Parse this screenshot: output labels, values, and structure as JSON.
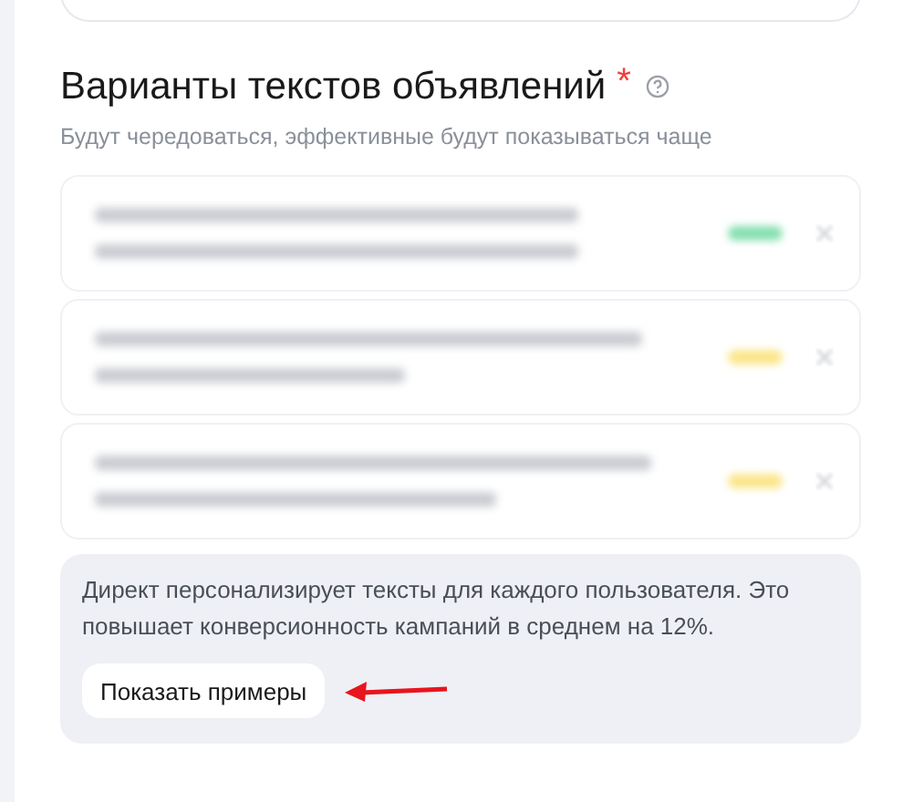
{
  "section": {
    "title": "Варианты текстов объявлений",
    "required_mark": "*",
    "subtitle": "Будут чередоваться, эффективные будут показываться чаще"
  },
  "variants": [
    {
      "color": "#86e0b0"
    },
    {
      "color": "#fbe68a"
    },
    {
      "color": "#fbe68a"
    }
  ],
  "info": {
    "text": "Директ персонализирует тексты для каждого пользователя. Это повышает конверсионность кампаний в среднем на 12%.",
    "button": "Показать примеры"
  }
}
